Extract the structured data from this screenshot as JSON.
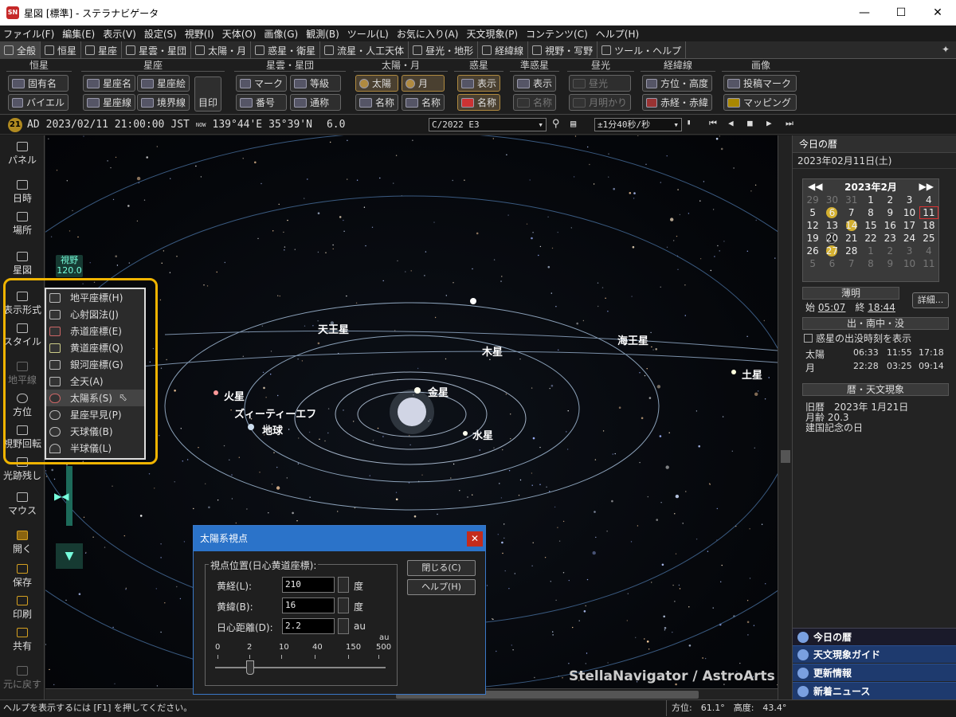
{
  "window": {
    "title": "星図 [標準] - ステラナビゲータ",
    "app_icon": "SN"
  },
  "menu": [
    "ファイル(F)",
    "編集(E)",
    "表示(V)",
    "設定(S)",
    "視野(I)",
    "天体(O)",
    "画像(G)",
    "観測(B)",
    "ツール(L)",
    "お気に入り(A)",
    "天文現象(P)",
    "コンテンツ(C)",
    "ヘルプ(H)"
  ],
  "tabs": [
    "全般",
    "恒星",
    "星座",
    "星雲・星団",
    "太陽・月",
    "惑星・衛星",
    "流星・人工天体",
    "昼光・地形",
    "経緯線",
    "視野・写野",
    "ツール・ヘルプ"
  ],
  "ribbon": {
    "groups": [
      "恒星",
      "星座",
      "星雲・星団",
      "太陽・月",
      "惑星",
      "準惑星",
      "昼光",
      "経緯線",
      "画像"
    ],
    "star": {
      "b1": "固有名",
      "b2": "バイエル"
    },
    "constellation": {
      "b1": "星座名",
      "b2": "星座線",
      "b3": "星座絵",
      "b4": "境界線",
      "b5": "目印"
    },
    "nebula": {
      "b1": "マーク",
      "b2": "番号",
      "b3": "等級",
      "b4": "通称"
    },
    "sunmoon": {
      "b1": "太陽",
      "b2": "月",
      "b3": "名称",
      "b4": "名称"
    },
    "planet": {
      "b1": "表示",
      "b2": "名称"
    },
    "dwarf": {
      "b1": "表示",
      "b2": "名称"
    },
    "daylight": {
      "b1": "昼光",
      "b2": "月明かり"
    },
    "grid": {
      "b1": "方位・高度",
      "b2": "赤経・赤緯"
    },
    "image": {
      "b1": "投稿マーク",
      "b2": "マッピング"
    }
  },
  "toolbar": {
    "badge": "21",
    "era": "AD",
    "datetime": "2023/02/11 21:00:00",
    "tz": "JST",
    "now": "NOW",
    "longitude": "139°44'E",
    "latitude": "35°39'N",
    "timestep_value": "6.0",
    "object": "C/2022 E3",
    "speed": "±1分40秒/秒"
  },
  "leftbar": {
    "panel": "パネル",
    "datetime": "日時",
    "place": "場所",
    "starmap": "星図",
    "display": "表示形式",
    "style": "スタイル",
    "horizon": "地平線",
    "direction": "方位",
    "rotate": "視野回転",
    "trail": "光跡残し",
    "mouse": "マウス",
    "open": "開く",
    "save": "保存",
    "print": "印刷",
    "share": "共有",
    "undo": "元に戻す"
  },
  "fov": {
    "label": "視野",
    "value": "120.0"
  },
  "popup_menu": [
    "地平座標(H)",
    "心射図法(J)",
    "赤道座標(E)",
    "黄道座標(Q)",
    "銀河座標(G)",
    "全天(A)",
    "太陽系(S)",
    "星座早見(P)",
    "天球儀(B)",
    "半球儀(L)"
  ],
  "planets": {
    "uranus": "天王星",
    "jupiter": "木星",
    "neptune": "海王星",
    "saturn": "土星",
    "mars": "火星",
    "venus": "金星",
    "ztf": "ズィーティーエフ",
    "earth": "地球",
    "mercury": "水星"
  },
  "watermark": "StellaNavigator / AstroArts",
  "dialog": {
    "title": "太陽系視点",
    "group": "視点位置(日心黄道座標):",
    "lon_label": "黄経(L):",
    "lon_value": "210",
    "lon_unit": "度",
    "lat_label": "黄緯(B):",
    "lat_value": "16",
    "lat_unit": "度",
    "dist_label": "日心距離(D):",
    "dist_value": "2.2",
    "dist_unit": "au",
    "scale_unit": "au",
    "ticks": [
      "0",
      "2",
      "10",
      "40",
      "150",
      "500"
    ],
    "slider_value": 2.2,
    "close": "閉じる(C)",
    "help": "ヘルプ(H)"
  },
  "rightpanel": {
    "title": "今日の暦",
    "date": "2023年02月11日(土)",
    "cal_title": "2023年2月",
    "weeks": [
      [
        "29",
        "30",
        "31",
        "1",
        "2",
        "3",
        "4"
      ],
      [
        "5",
        "6",
        "7",
        "8",
        "9",
        "10",
        "11"
      ],
      [
        "12",
        "13",
        "14",
        "15",
        "16",
        "17",
        "18"
      ],
      [
        "19",
        "20",
        "21",
        "22",
        "23",
        "24",
        "25"
      ],
      [
        "26",
        "27",
        "28",
        "1",
        "2",
        "3",
        "4"
      ],
      [
        "5",
        "6",
        "7",
        "8",
        "9",
        "10",
        "11"
      ]
    ],
    "twilight": "薄明",
    "twilight_start_label": "始",
    "twilight_start": "05:07",
    "twilight_end_label": "終",
    "twilight_end": "18:44",
    "detail_button": "詳細...",
    "rise_set": "出・南中・没",
    "planet_checkbox": "惑星の出没時刻を表示",
    "sun": {
      "name": "太陽",
      "rise": "06:33",
      "transit": "11:55",
      "set": "17:18"
    },
    "moon": {
      "name": "月",
      "rise": "22:28",
      "transit": "03:25",
      "set": "09:14"
    },
    "calendar_events": "暦・天文現象",
    "lunar": "旧暦　2023年 1月21日",
    "moon_age": "月齢 20.3",
    "holiday": "建国記念の日",
    "nav": [
      "今日の暦",
      "天文現象ガイド",
      "更新情報",
      "新着ニュース"
    ]
  },
  "status": {
    "help": "ヘルプを表示するには [F1] を押してください。",
    "position": "方位:　61.1°　高度:　43.4°"
  },
  "colors": {
    "accent": "#f0b400",
    "dialog_title": "#2b73c9",
    "nav_blue": "#1e3a6e"
  }
}
